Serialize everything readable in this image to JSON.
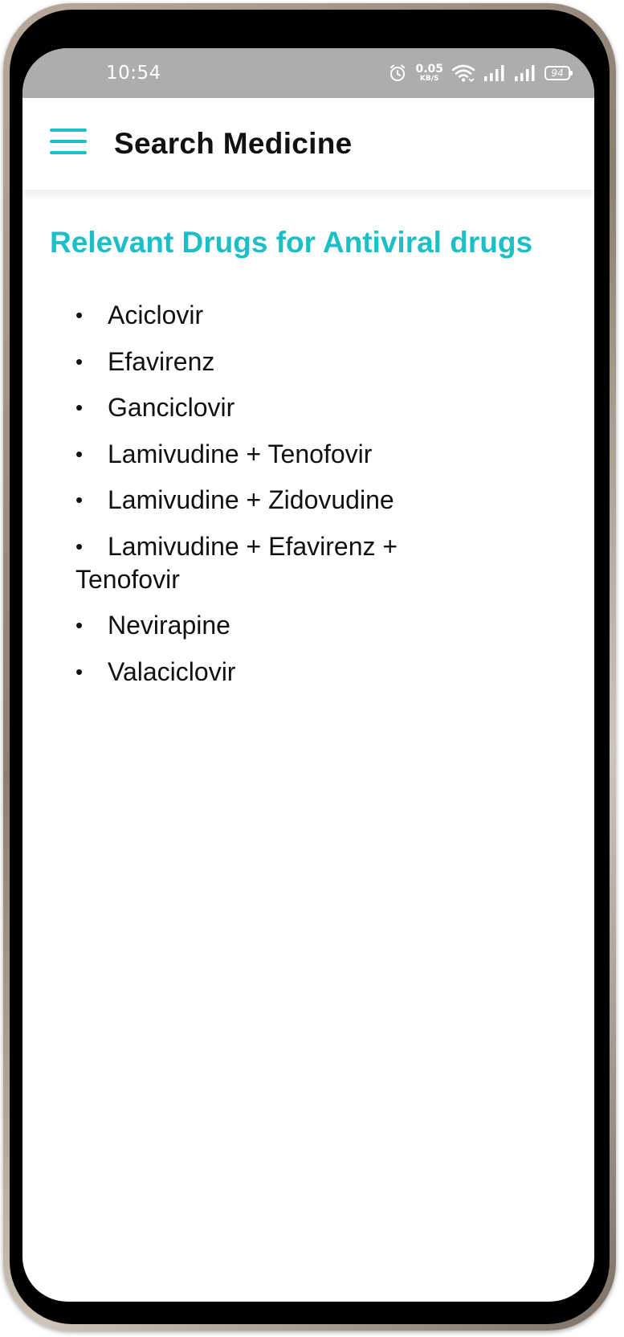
{
  "status_bar": {
    "time": "10:54",
    "net_speed_value": "0.05",
    "net_speed_unit": "KB/S",
    "battery_level": "94"
  },
  "app_bar": {
    "title": "Search Medicine",
    "menu_icon": "hamburger-menu-icon"
  },
  "content": {
    "heading": "Relevant Drugs for Antiviral drugs",
    "bullet": "•",
    "drugs": [
      "Aciclovir",
      "Efavirenz",
      "Ganciclovir",
      "Lamivudine + Tenofovir",
      "Lamivudine + Zidovudine",
      "Lamivudine + Efavirenz + Tenofovir",
      "Nevirapine",
      "Valaciclovir"
    ]
  },
  "colors": {
    "accent": "#1cbfc7",
    "status_bar_bg": "#adadad",
    "text": "#111111",
    "background": "#ffffff"
  }
}
